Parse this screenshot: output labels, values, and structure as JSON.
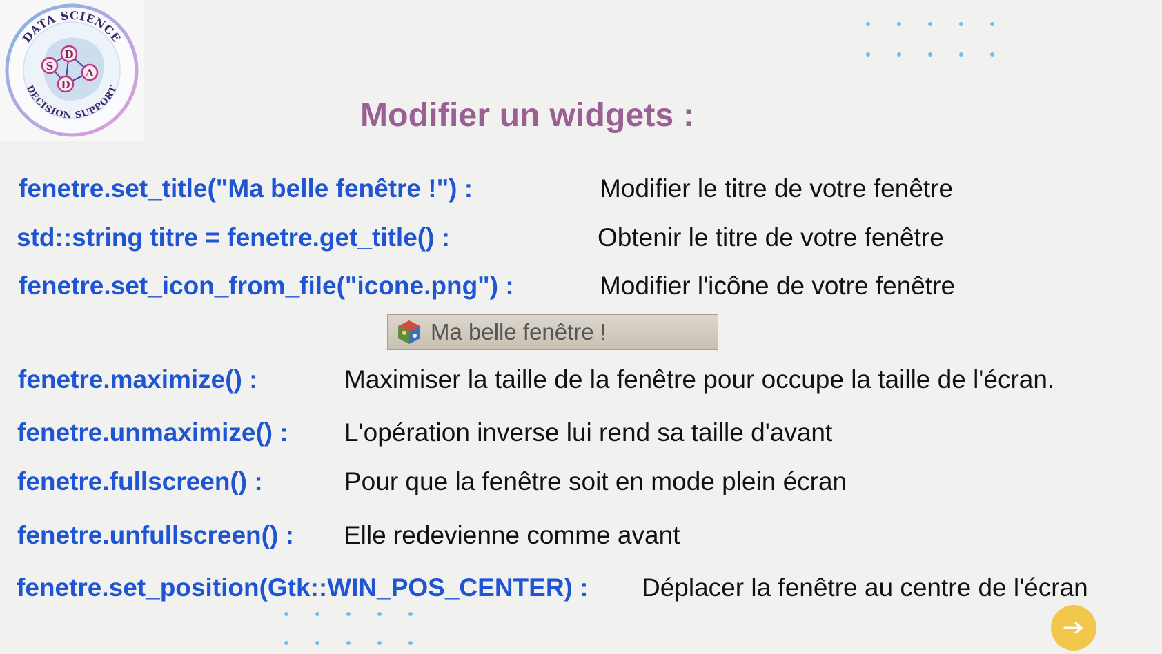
{
  "logo": {
    "ring_text_top": "DATA SCIENCE",
    "ring_text_bottom": "DECISION SUPPORT",
    "letters": [
      "D",
      "S",
      "A",
      "D"
    ]
  },
  "slide": {
    "title": "Modifier un widgets :",
    "rows": [
      {
        "code": "fenetre.set_title(\"Ma belle fenêtre !\") :",
        "desc": "Modifier le titre de votre fenêtre"
      },
      {
        "code": "std::string titre = fenetre.get_title() :",
        "desc": "Obtenir le titre de votre fenêtre"
      },
      {
        "code": "fenetre.set_icon_from_file(\"icone.png\") :",
        "desc": "Modifier l'icône de votre fenêtre"
      },
      {
        "code": "fenetre.maximize() :",
        "desc": "Maximiser la taille de la fenêtre pour occupe la taille de l'écran."
      },
      {
        "code": "fenetre.unmaximize() :",
        "desc": "L'opération inverse lui rend sa taille d'avant"
      },
      {
        "code": "fenetre.fullscreen() :",
        "desc": "Pour que la fenêtre soit en mode plein écran"
      },
      {
        "code": "fenetre.unfullscreen() :",
        "desc": "Elle redevienne comme avant"
      },
      {
        "code": "fenetre.set_position(Gtk::WIN_POS_CENTER) :",
        "desc": "Déplacer la fenêtre au centre de l'écran"
      }
    ],
    "window_title_example": "Ma belle fenêtre !",
    "next_button_icon": "arrow-right-icon"
  },
  "colors": {
    "title": "#9a5f93",
    "code": "#1f55d3",
    "desc": "#111111",
    "dots": "#6ec0e8",
    "next_button": "#f1c84b"
  }
}
